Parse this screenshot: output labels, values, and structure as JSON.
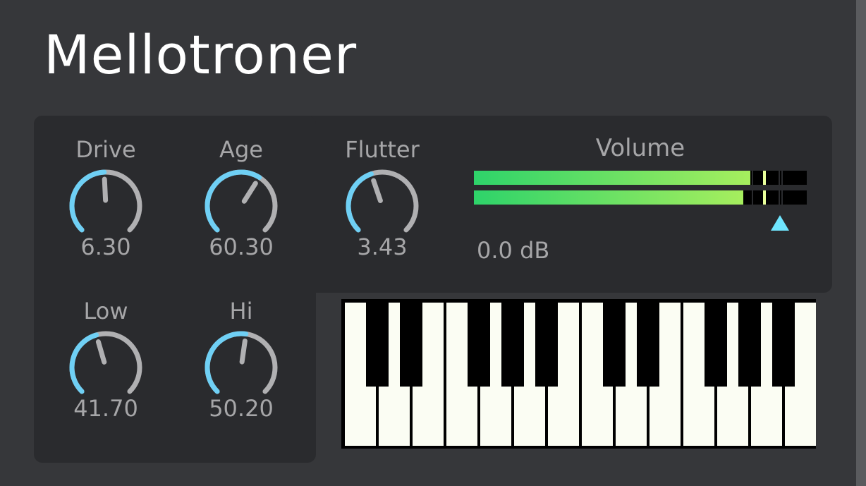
{
  "app": {
    "title": "Mellotroner"
  },
  "knobs": [
    {
      "id": "drive",
      "label": "Drive",
      "value": "6.30",
      "level": 0.49
    },
    {
      "id": "age",
      "label": "Age",
      "value": "60.30",
      "level": 0.62
    },
    {
      "id": "flutter",
      "label": "Flutter",
      "value": "3.43",
      "level": 0.43
    },
    {
      "id": "low",
      "label": "Low",
      "value": "41.70",
      "level": 0.44
    },
    {
      "id": "hi",
      "label": "Hi",
      "value": "50.20",
      "level": 0.53
    }
  ],
  "volume": {
    "label": "Volume",
    "readout": "0.0 dB",
    "meter_left_level": 0.83,
    "meter_right_level": 0.81,
    "fader_level": 0.92
  },
  "keyboard": {
    "white_keys": 14,
    "octaves": 2
  },
  "colors": {
    "background": "#36373a",
    "panel": "#2a2b2e",
    "accent": "#6fd0f5",
    "knob_track": "#b0b0b2",
    "label": "#a6a6a8",
    "meter_start": "#2ed36a",
    "meter_end": "#a6ee5e",
    "pointer": "#6fe6ff"
  }
}
